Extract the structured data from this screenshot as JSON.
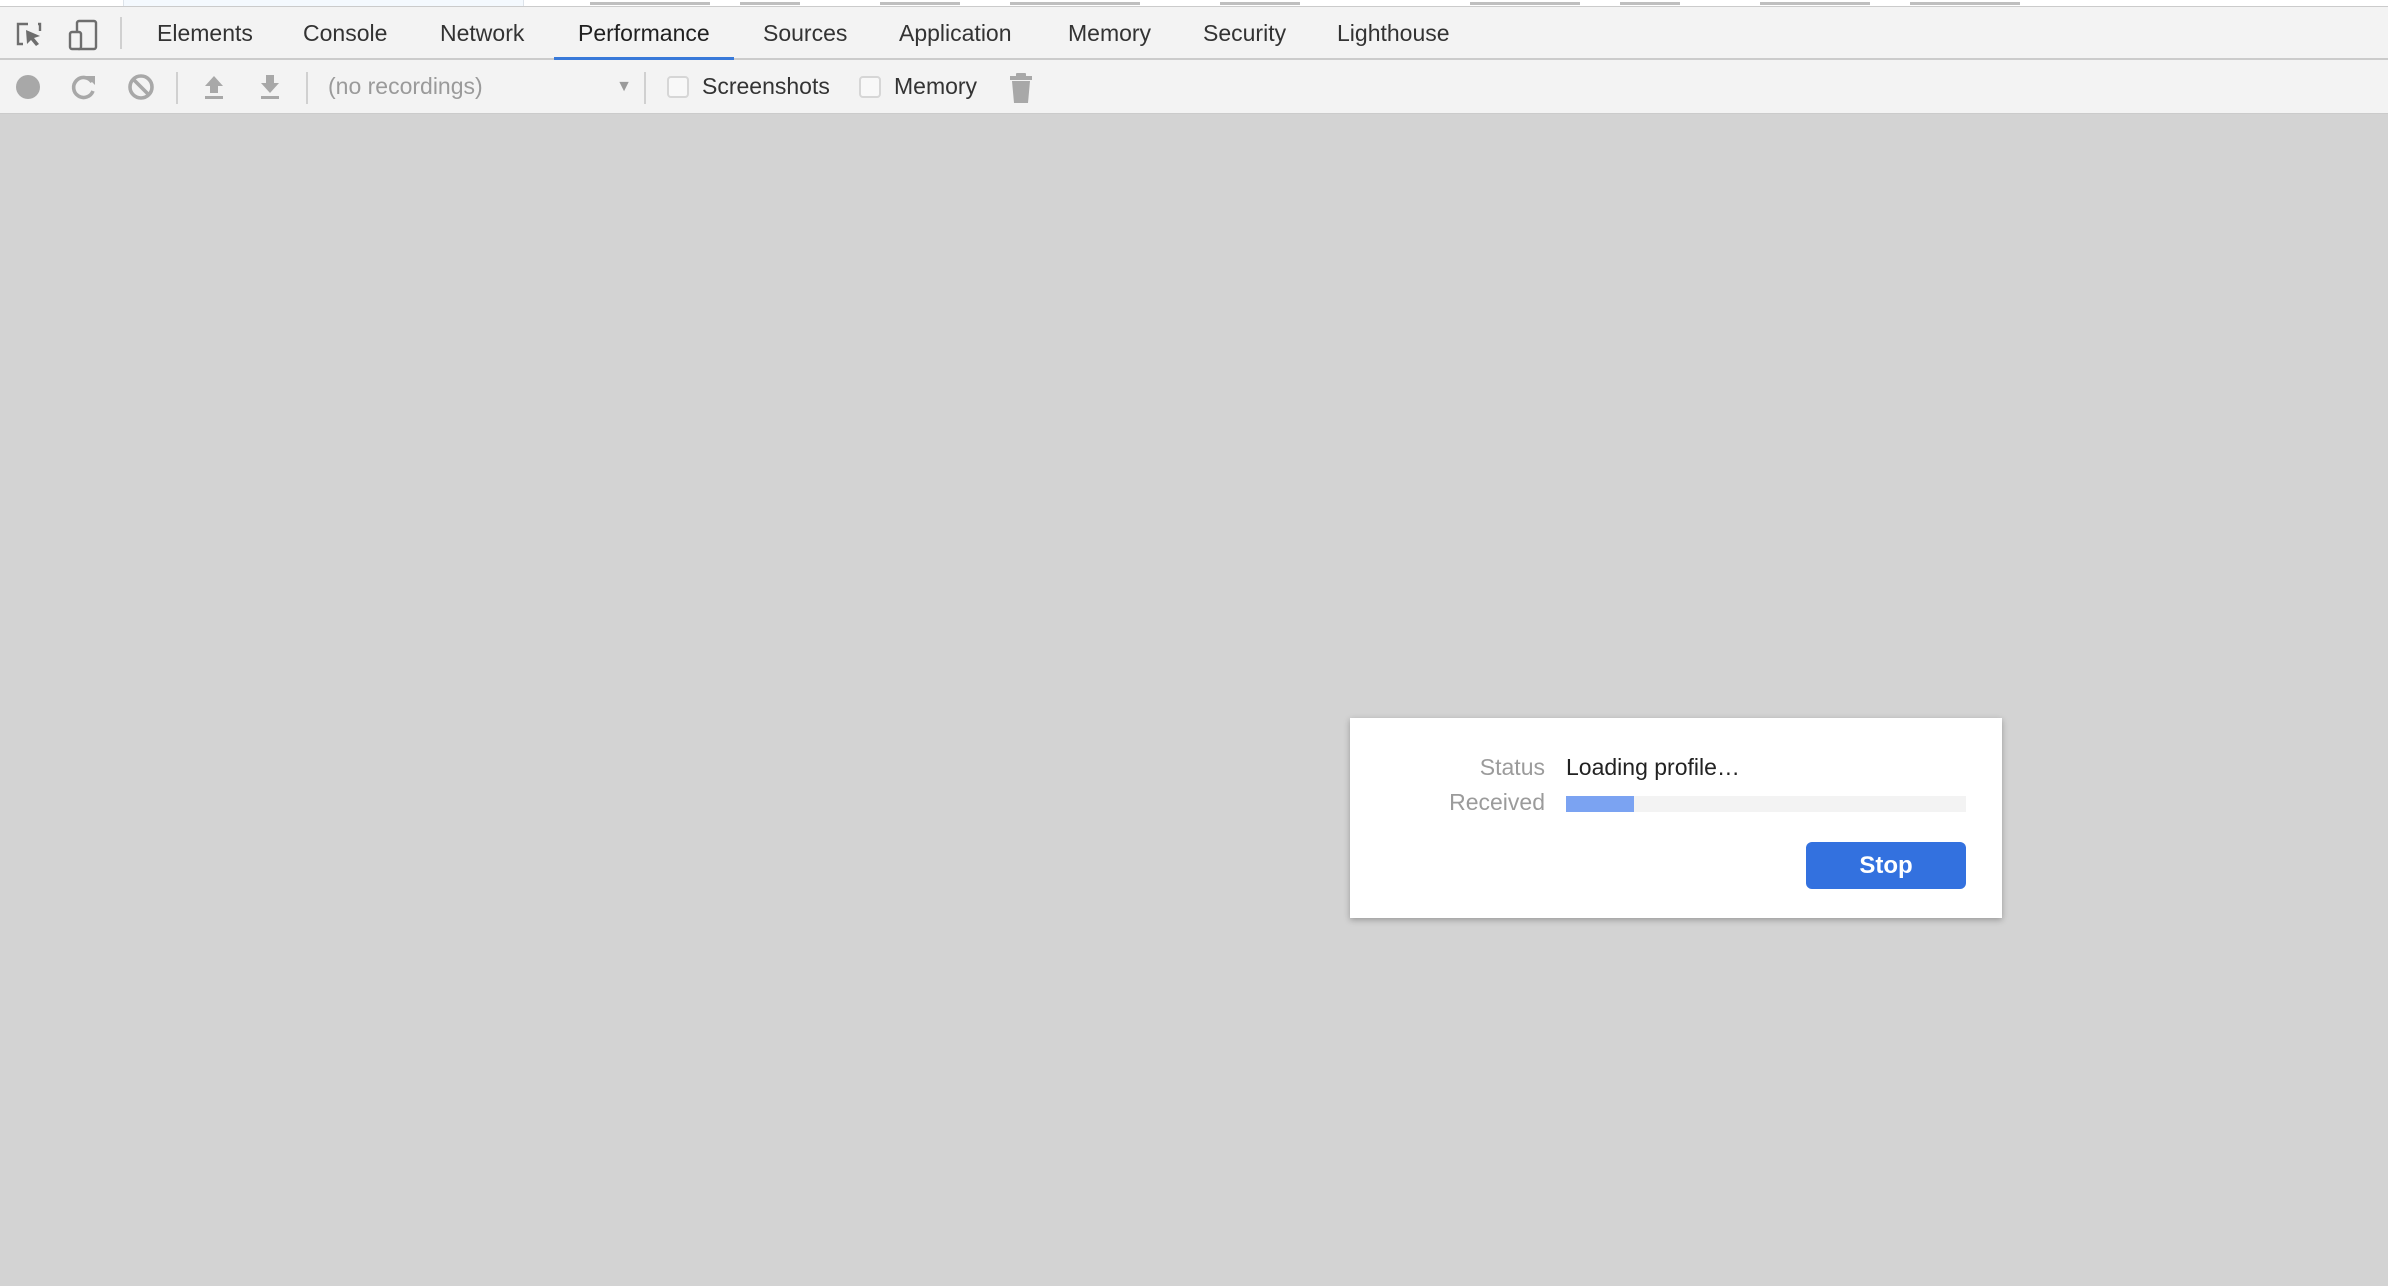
{
  "devtools": {
    "left_icons": [
      {
        "name": "inspect-element-icon"
      },
      {
        "name": "device-toolbar-icon"
      }
    ],
    "tabs": [
      {
        "label": "Elements",
        "active": false
      },
      {
        "label": "Console",
        "active": false
      },
      {
        "label": "Network",
        "active": false
      },
      {
        "label": "Performance",
        "active": true
      },
      {
        "label": "Sources",
        "active": false
      },
      {
        "label": "Application",
        "active": false
      },
      {
        "label": "Memory",
        "active": false
      },
      {
        "label": "Security",
        "active": false
      },
      {
        "label": "Lighthouse",
        "active": false
      }
    ],
    "accent_color": "#3879d9"
  },
  "toolbar": {
    "buttons": [
      {
        "name": "record-icon",
        "enabled": false
      },
      {
        "name": "reload-icon",
        "enabled": false
      },
      {
        "name": "clear-icon",
        "enabled": false
      },
      {
        "name": "load-profile-icon",
        "enabled": false
      },
      {
        "name": "save-profile-icon",
        "enabled": false
      }
    ],
    "recordings_select": "(no recordings)",
    "checkboxes": [
      {
        "label": "Screenshots",
        "checked": false
      },
      {
        "label": "Memory",
        "checked": false
      }
    ],
    "trash_icon": "trash-icon"
  },
  "dialog": {
    "status_label": "Status",
    "status_value": "Loading profile…",
    "received_label": "Received",
    "received_progress_percent": 17,
    "stop_button": "Stop",
    "button_color": "#3371df",
    "progress_color": "#7ba3f2"
  }
}
